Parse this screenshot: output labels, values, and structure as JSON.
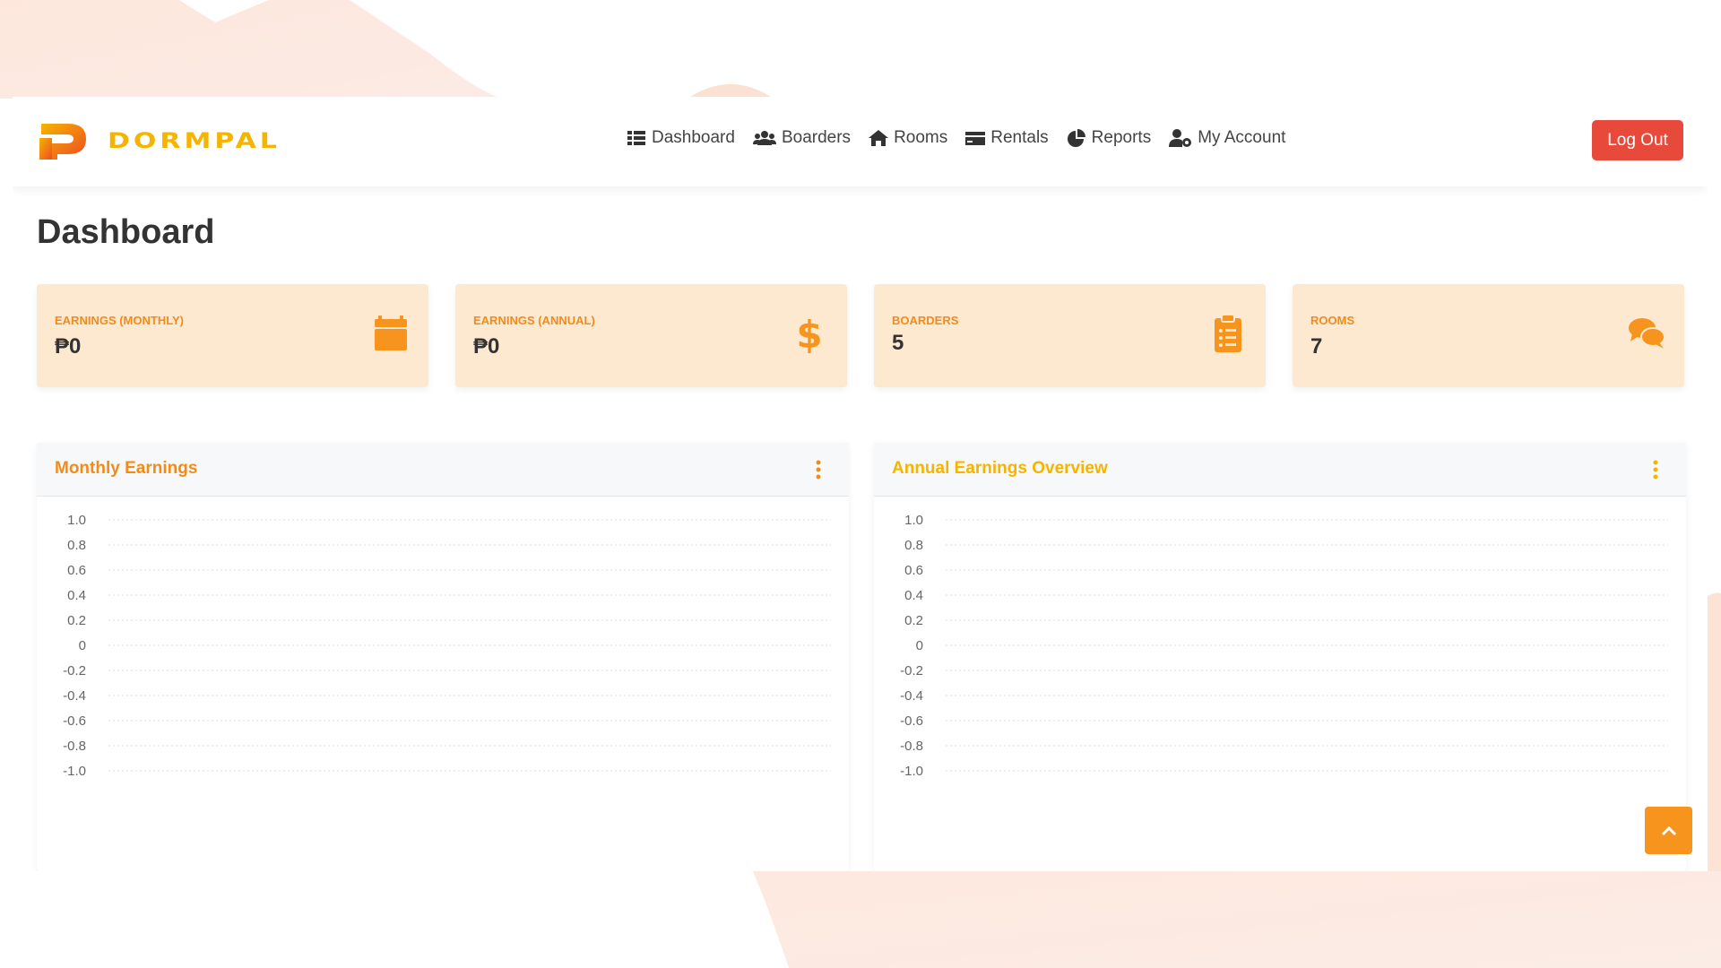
{
  "brand": {
    "name": "DORMPAL",
    "logo_letter": "P"
  },
  "nav": {
    "items": [
      {
        "label": "Dashboard",
        "icon": "table-icon"
      },
      {
        "label": "Boarders",
        "icon": "users-icon"
      },
      {
        "label": "Rooms",
        "icon": "home-icon"
      },
      {
        "label": "Rentals",
        "icon": "credit-card-icon"
      },
      {
        "label": "Reports",
        "icon": "pie-chart-icon"
      },
      {
        "label": "My Account",
        "icon": "user-cog-icon"
      }
    ],
    "logout_label": "Log Out"
  },
  "page": {
    "title": "Dashboard"
  },
  "cards": [
    {
      "label": "EARNINGS (MONTHLY)",
      "value": "₱0",
      "icon": "calendar-icon"
    },
    {
      "label": "EARNINGS (ANNUAL)",
      "value": "₱0",
      "icon": "dollar-icon"
    },
    {
      "label": "BOARDERS",
      "value": "5",
      "icon": "clipboard-list-icon"
    },
    {
      "label": "ROOMS",
      "value": "7",
      "icon": "comments-icon"
    }
  ],
  "panels": [
    {
      "title": "Monthly Earnings",
      "title_color": "#f28b1a"
    },
    {
      "title": "Annual Earnings Overview",
      "title_color": "#f5b400"
    }
  ],
  "colors": {
    "accent": "#f7941d",
    "card_bg": "#fde8d0",
    "logout": "#e74a3b",
    "brand_yellow": "#f5b400"
  },
  "chart_data": [
    {
      "type": "line",
      "title": "",
      "xlabel": "",
      "ylabel": "",
      "ylim": [
        -1.0,
        1.0
      ],
      "yticks": [
        "1.0",
        "0.8",
        "0.6",
        "0.4",
        "0.2",
        "0",
        "-0.2",
        "-0.4",
        "-0.6",
        "-0.8",
        "-1.0"
      ],
      "series": [],
      "grid": true
    },
    {
      "type": "line",
      "title": "",
      "xlabel": "",
      "ylabel": "",
      "ylim": [
        -1.0,
        1.0
      ],
      "yticks": [
        "1.0",
        "0.8",
        "0.6",
        "0.4",
        "0.2",
        "0",
        "-0.2",
        "-0.4",
        "-0.6",
        "-0.8",
        "-1.0"
      ],
      "series": [],
      "grid": true
    }
  ]
}
